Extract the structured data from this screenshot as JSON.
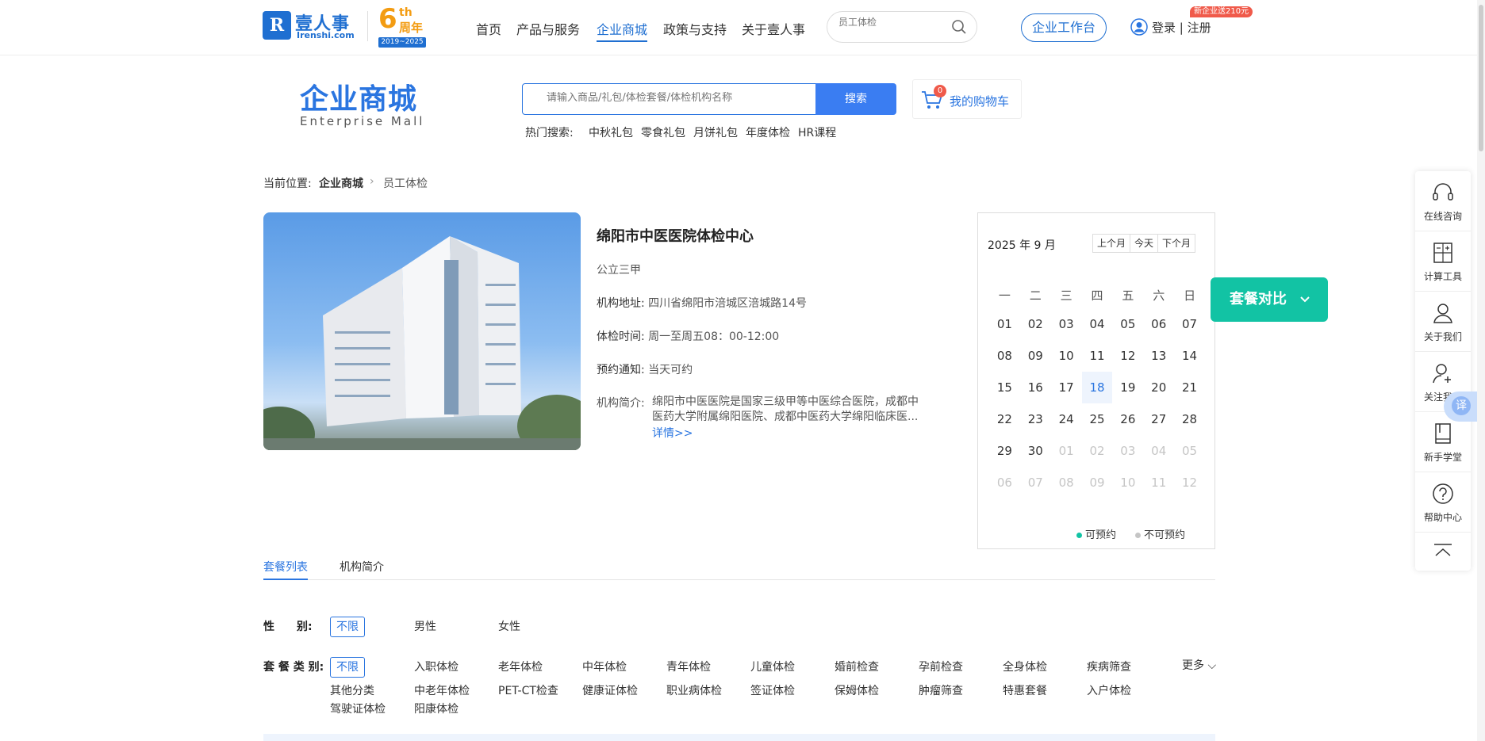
{
  "header": {
    "logo_mark": "R",
    "logo_cn": "壹人事",
    "logo_en": "Irenshi.com",
    "anniversary": {
      "num": "6",
      "suffix": "th",
      "label": "周年",
      "years": "2019~2025"
    },
    "nav": [
      "首页",
      "产品与服务",
      "企业商城",
      "政策与支持",
      "关于壹人事"
    ],
    "active_nav": "企业商城",
    "search_placeholder": "员工体检",
    "workbench_label": "企业工作台",
    "login_label": "登录 | 注册",
    "promo_badge": "新企业送210元"
  },
  "mall": {
    "title": "企业商城",
    "subtitle": "Enterprise  Mall",
    "search_placeholder": "请输入商品/礼包/体检套餐/体检机构名称",
    "search_button": "搜索",
    "cart_count": "0",
    "cart_label": "我的购物车",
    "hot_label": "热门搜索:",
    "hot_items": [
      "中秋礼包",
      "零食礼包",
      "月饼礼包",
      "年度体检",
      "HR课程"
    ]
  },
  "breadcrumb": {
    "prefix": "当前位置:",
    "parent": "企业商城",
    "current": "员工体检"
  },
  "institution": {
    "name": "绵阳市中医医院体检中心",
    "level": "公立三甲",
    "address_label": "机构地址:",
    "address": "四川省绵阳市涪城区涪城路14号",
    "hours_label": "体检时间:",
    "hours": "周一至周五08：00-12:00",
    "notice_label": "预约通知:",
    "notice": "当天可约",
    "intro_label": "机构简介:",
    "intro": "绵阳市中医医院是国家三级甲等中医综合医院，成都中医药大学附属绵阳医院、成都中医药大学绵阳临床医...",
    "more_link": "详情>>"
  },
  "calendar": {
    "title": "2025 年 9 月",
    "buttons": [
      "上个月",
      "今天",
      "下个月"
    ],
    "weekdays": [
      "一",
      "二",
      "三",
      "四",
      "五",
      "六",
      "日"
    ],
    "days": [
      [
        "01",
        "02",
        "03",
        "04",
        "05",
        "06",
        "07"
      ],
      [
        "08",
        "09",
        "10",
        "11",
        "12",
        "13",
        "14"
      ],
      [
        "15",
        "16",
        "17",
        "18",
        "19",
        "20",
        "21"
      ],
      [
        "22",
        "23",
        "24",
        "25",
        "26",
        "27",
        "28"
      ],
      [
        "29",
        "30",
        "01",
        "02",
        "03",
        "04",
        "05"
      ],
      [
        "06",
        "07",
        "08",
        "09",
        "10",
        "11",
        "12"
      ]
    ],
    "today": "18",
    "legend": [
      {
        "label": "可预约",
        "color": "#12c3a4"
      },
      {
        "label": "不可预约",
        "color": "#c5c5c5"
      }
    ]
  },
  "compare_button": "套餐对比",
  "sidebar": [
    "在线咨询",
    "计算工具",
    "关于我们",
    "关注我们",
    "新手学堂",
    "帮助中心"
  ],
  "translate_label": "译",
  "tabs": [
    "套餐列表",
    "机构简介"
  ],
  "filters": {
    "gender_label": "性　　别:",
    "gender_options": [
      "不限",
      "男性",
      "女性"
    ],
    "type_label": "套 餐 类 别:",
    "type_options": [
      "不限",
      "入职体检",
      "老年体检",
      "中年体检",
      "青年体检",
      "儿童体检",
      "婚前检查",
      "孕前检查",
      "全身体检",
      "疾病筛查"
    ],
    "type_options_row2": [
      "其他分类",
      "中老年体检",
      "PET-CT检查",
      "健康证体检",
      "职业病体检",
      "签证体检",
      "保姆体检",
      "肿瘤筛查",
      "特惠套餐",
      "入户体检"
    ],
    "type_options_row3": [
      "驾驶证体检",
      "阳康体检"
    ],
    "more_label": "更多"
  },
  "colors": {
    "brand": "#1f6fd1",
    "accent": "#12c3a4",
    "button": "#3a7df2"
  }
}
